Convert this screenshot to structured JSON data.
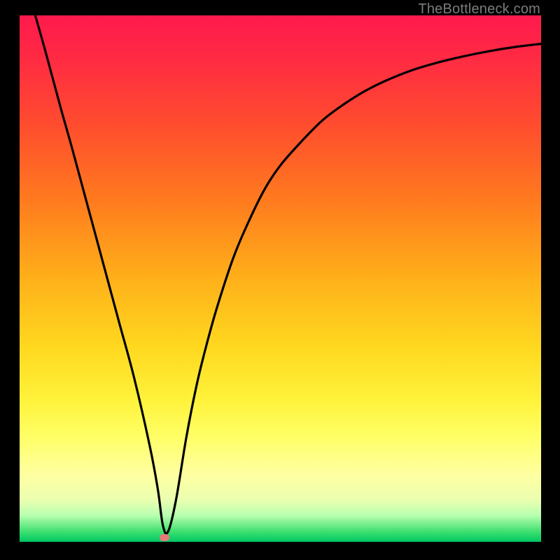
{
  "watermark": {
    "text": "TheBottleneck.com"
  },
  "chart_data": {
    "type": "line",
    "title": "",
    "xlabel": "",
    "ylabel": "",
    "xlim": [
      0,
      100
    ],
    "ylim": [
      0,
      100
    ],
    "series": [
      {
        "name": "curve",
        "x": [
          3,
          5,
          8,
          10,
          13,
          16,
          19,
          22,
          25,
          26.5,
          27.5,
          28.5,
          30,
          32,
          34,
          36,
          38,
          41,
          44,
          47,
          50,
          54,
          58,
          62,
          66,
          70,
          75,
          80,
          85,
          90,
          95,
          100
        ],
        "values": [
          100,
          93,
          82,
          75,
          64,
          53,
          42,
          31,
          18,
          10,
          3,
          2,
          8,
          20,
          30,
          38,
          45,
          54,
          61,
          67,
          71.5,
          76,
          80,
          83,
          85.5,
          87.5,
          89.5,
          91,
          92.2,
          93.2,
          94,
          94.6
        ]
      }
    ],
    "marker": {
      "x": 27.8,
      "y": 0.8,
      "color": "#e87878"
    },
    "background_gradient": {
      "top": "#ff1a4d",
      "mid": "#ffd81f",
      "bottom": "#00c864"
    }
  }
}
